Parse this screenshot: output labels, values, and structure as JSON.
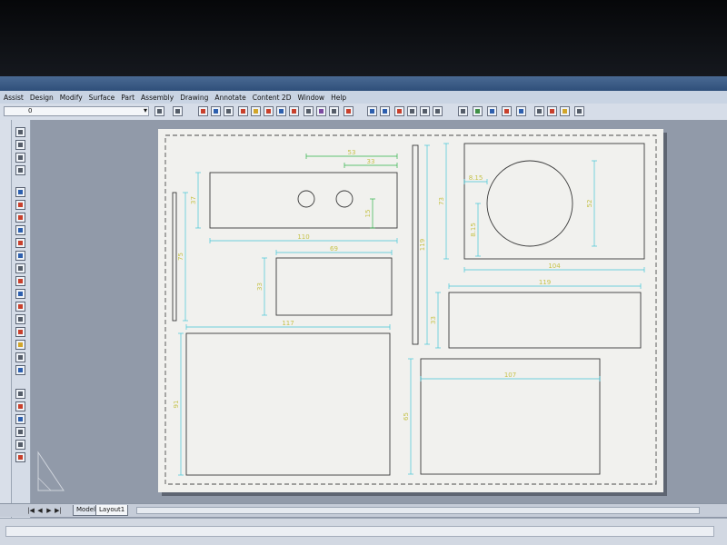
{
  "menubar": {
    "items": [
      "Assist",
      "Design",
      "Modify",
      "Surface",
      "Part",
      "Assembly",
      "Drawing",
      "Annotate",
      "Content 2D",
      "Window",
      "Help"
    ]
  },
  "toolbar": {
    "layer_value": "0",
    "icons": [
      "layer-icon",
      "undo-icon",
      "redo-icon",
      "snap-icon",
      "ortho-icon",
      "grid-icon",
      "pan-icon",
      "zoom-icon",
      "properties-icon",
      "help-icon"
    ]
  },
  "drawing": {
    "dimensions": {
      "plate1_width": "110",
      "holes_span_outer": "53",
      "holes_span_inner": "33",
      "hole_height": "15",
      "plate1_height": "37",
      "left_strip_height": "75",
      "small_plate_width": "69",
      "small_plate_height": "33",
      "large_plate_width": "117",
      "large_plate_height": "91",
      "tall_strip_height": "119",
      "circle_plate_height": "73",
      "circle_plate_width": "104",
      "circle_diameter": "52",
      "circle_offset_x": "8.15",
      "circle_offset_y": "8.15",
      "right_plate_width": "119",
      "right_plate_height": "33",
      "bottom_right_width": "107",
      "bottom_right_height": "65"
    },
    "colors": {
      "outline": "#3a3a3a",
      "dimension": "#42c5d6",
      "dimension_text": "#c5c24a",
      "green_dim": "#2fb24a",
      "border_dash": "#4b4b4b"
    }
  },
  "tabs": {
    "model": "Model",
    "layout": "Layout1",
    "nav": [
      "|◀",
      "◀",
      "▶",
      "▶|"
    ]
  }
}
